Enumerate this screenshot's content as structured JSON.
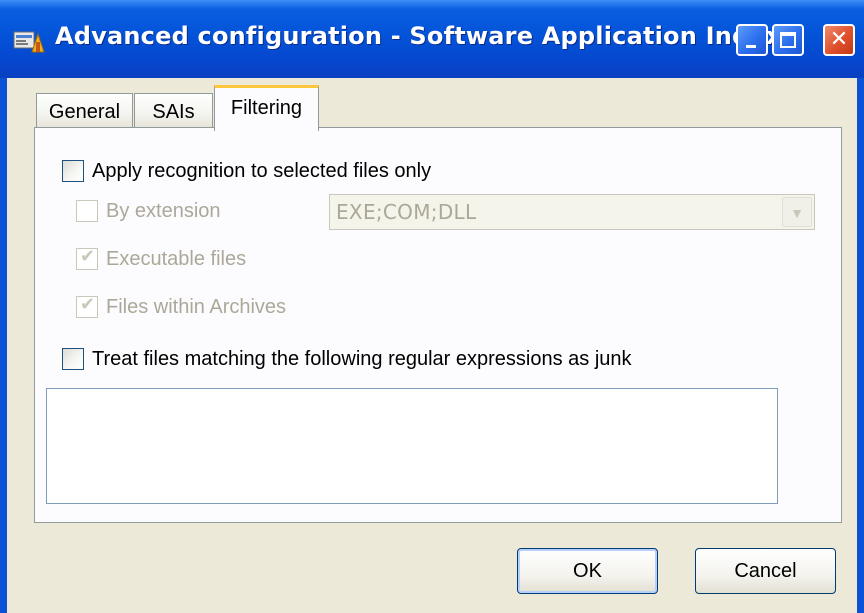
{
  "window": {
    "title": "Advanced configuration - Software Application Index",
    "icon": "app-icon",
    "controls": [
      "minimize-icon",
      "maximize-icon",
      "close-icon"
    ]
  },
  "tabs": [
    {
      "label": "General",
      "active": false
    },
    {
      "label": "SAIs",
      "active": false
    },
    {
      "label": "Filtering",
      "active": true
    }
  ],
  "filtering": {
    "apply_recognition": {
      "label": "Apply recognition to selected files only",
      "checked": false
    },
    "by_extension": {
      "label": "By extension",
      "checked": false,
      "enabled": false
    },
    "extension_value": "EXE;COM;DLL",
    "executable_files": {
      "label": "Executable files",
      "checked": true,
      "enabled": false
    },
    "files_within_archives": {
      "label": "Files within Archives",
      "checked": true,
      "enabled": false
    },
    "treat_as_junk": {
      "label": "Treat files matching the following regular expressions as junk",
      "checked": false
    },
    "regex_text": ""
  },
  "buttons": {
    "ok": "OK",
    "cancel": "Cancel"
  },
  "colors": {
    "title_bar": "#0453d8",
    "dialog_face": "#ece9d8",
    "active_tab_accent": "#ffc83c",
    "disabled_text": "#aca899"
  }
}
